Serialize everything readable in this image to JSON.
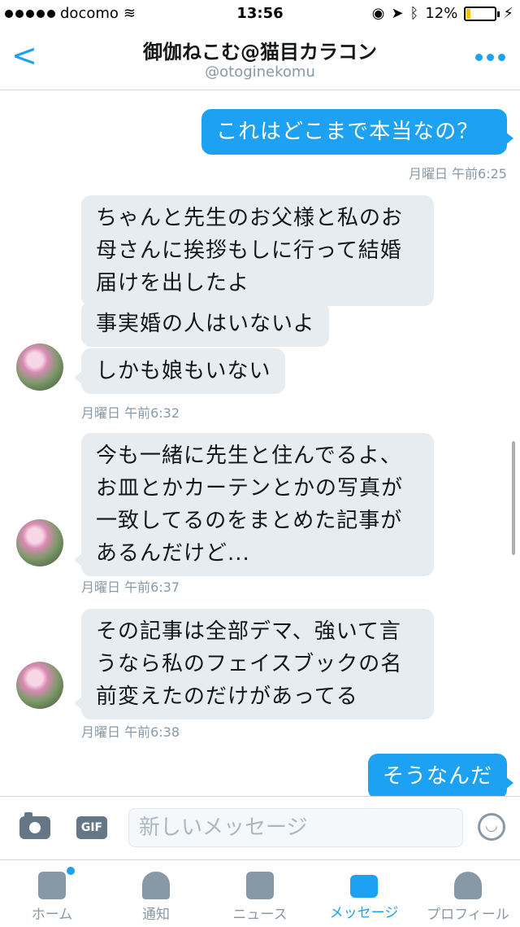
{
  "status": {
    "carrier": "docomo",
    "time": "13:56",
    "battery": "12%"
  },
  "header": {
    "title": "御伽ねこむ@猫目カラコン",
    "handle": "@otoginekomu"
  },
  "messages": [
    {
      "dir": "out",
      "text": "これはどこまで本当なの？"
    },
    {
      "ts": "月曜日 午前6:25"
    },
    {
      "dir": "in",
      "text": "ちゃんと先生のお父様と私のお母さんに挨拶もしに行って結婚届けを出したよ"
    },
    {
      "dir": "in",
      "text": "事実婚の人はいないよ"
    },
    {
      "dir": "in",
      "text": "しかも娘もいない"
    },
    {
      "ts": "月曜日 午前6:32"
    },
    {
      "dir": "in",
      "text": "今も一緒に先生と住んでるよ、お皿とかカーテンとかの写真が一致してるのをまとめた記事があるんだけど..."
    },
    {
      "ts": "月曜日 午前6:37"
    },
    {
      "dir": "in",
      "text": "その記事は全部デマ、強いて言うなら私のフェイスブックの名前変えたのだけがあってる"
    },
    {
      "ts": "月曜日 午前6:38"
    },
    {
      "dir": "out",
      "text": "そうなんだ"
    }
  ],
  "composer": {
    "placeholder": "新しいメッセージ",
    "gif_label": "GIF"
  },
  "tabs": [
    {
      "label": "ホーム",
      "icon": "home-icon"
    },
    {
      "label": "通知",
      "icon": "bell-icon"
    },
    {
      "label": "ニュース",
      "icon": "news-icon"
    },
    {
      "label": "メッセージ",
      "icon": "envelope-icon"
    },
    {
      "label": "プロフィール",
      "icon": "person-icon"
    }
  ],
  "colors": {
    "accent": "#1da1f2",
    "incoming_bubble": "#e6ecf0",
    "muted": "#8899a6"
  }
}
